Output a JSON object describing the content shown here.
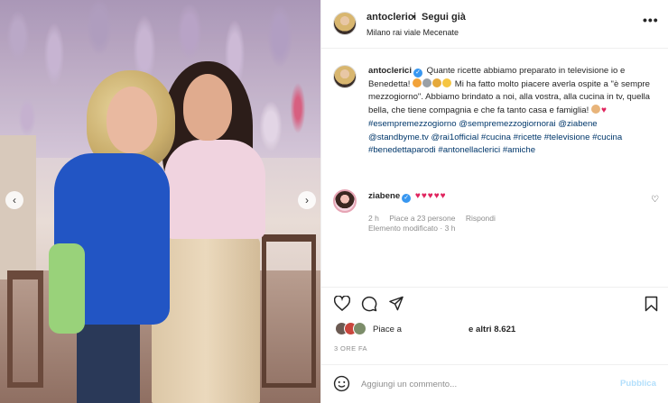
{
  "post": {
    "username": "antoclerici",
    "follow_separator": "•",
    "follow_label": "Segui già",
    "location": "Milano rai viale Mecenate",
    "more_icon": "more-horizontal-icon"
  },
  "caption": {
    "username": "antoclerici",
    "part1": "Quante ricette abbiamo preparato in televisione io e Benedetta!",
    "part2": "Mi ha fatto molto piacere averla ospite a \"è sempre mezzogiorno\". Abbiamo brindato a noi, alla vostra, alla cucina in tv, quella bella, che tiene compagnia e che fa tanto casa e famiglia!",
    "tag1": "#esempremezzogiorno",
    "tag2": "@sempremezzogiornorai",
    "tag3": "@ziabene",
    "tag4": "@standbyme.tv",
    "tag5": "@rai1official",
    "tag6": "#cucina",
    "tag7": "#ricette",
    "tag8": "#televisione",
    "tag9": "#cucina",
    "tag10": "#benedettaparodi",
    "tag11": "#antonellaclerici",
    "tag12": "#amiche",
    "edited": "Elemento modificato",
    "edited_sep": "·",
    "edited_time": "3 h"
  },
  "reply": {
    "username": "ziabene",
    "time": "2 h",
    "likes": "Piace a 23 persone",
    "reply_label": "Rispondi"
  },
  "likes": {
    "prefix": "Piace a",
    "others": "e altri 8.621"
  },
  "timestamp": "3 ORE FA",
  "add_comment": {
    "placeholder": "Aggiungi un commento...",
    "publish": "Pubblica"
  },
  "colors": {
    "verified": "#3897f0",
    "heart": "#e0245e",
    "link": "#00376b",
    "publish_disabled": "#b2dffc"
  }
}
